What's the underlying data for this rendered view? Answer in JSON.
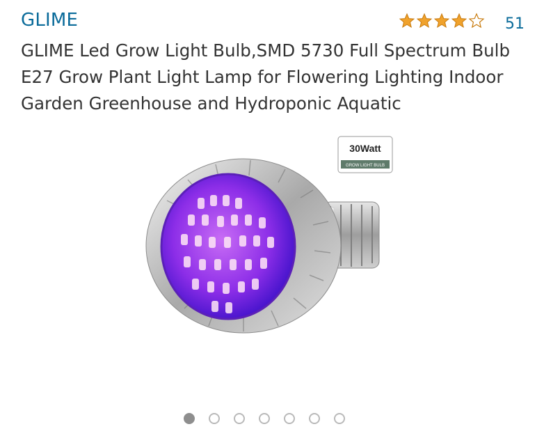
{
  "product": {
    "brand": "GLIME",
    "title": "GLIME Led Grow Light Bulb,SMD 5730 Full Spectrum Bulb E27 Grow Plant Light Lamp for Flowering Lighting Indoor Garden Greenhouse and Hydroponic Aquatic",
    "rating": 4.0,
    "rating_max": 5,
    "review_count": "51",
    "image": {
      "badge_text": "30Watt",
      "badge_subtext": "GROW LIGHT BULB"
    }
  },
  "carousel": {
    "total": 7,
    "active_index": 0
  },
  "colors": {
    "link": "#0a6b9a",
    "star": "#f0a22c",
    "text": "#333333",
    "dot_active": "#8e8e8e",
    "dot_inactive": "#b9b9b9"
  }
}
